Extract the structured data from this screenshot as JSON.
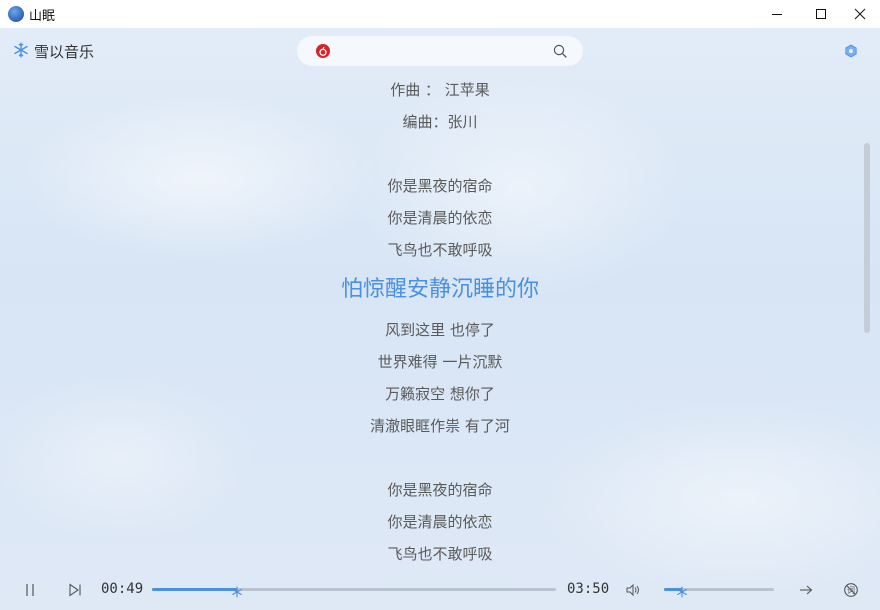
{
  "window": {
    "title": "山眠"
  },
  "brand": {
    "name": "雪以音乐",
    "icon": "snowflake-icon"
  },
  "search": {
    "value": "",
    "placeholder": "",
    "source_icon": "netease-logo-icon"
  },
  "lyrics": {
    "lines": [
      "作曲 ： 江苹果",
      "编曲：张川",
      "",
      "你是黑夜的宿命",
      "你是清晨的依恋",
      "飞鸟也不敢呼吸",
      "怕惊醒安静沉睡的你",
      "风到这里  也停了",
      "世界难得  一片沉默",
      "万籁寂空  想你了",
      "清澈眼眶作祟  有了河",
      "",
      "你是黑夜的宿命",
      "你是清晨的依恋",
      "飞鸟也不敢呼吸"
    ],
    "current_index": 6
  },
  "player": {
    "elapsed": "00:49",
    "duration": "03:50",
    "progress": 0.21,
    "volume": 0.16
  },
  "colors": {
    "accent": "#4a8fe0",
    "netease_red": "#d8232a"
  }
}
